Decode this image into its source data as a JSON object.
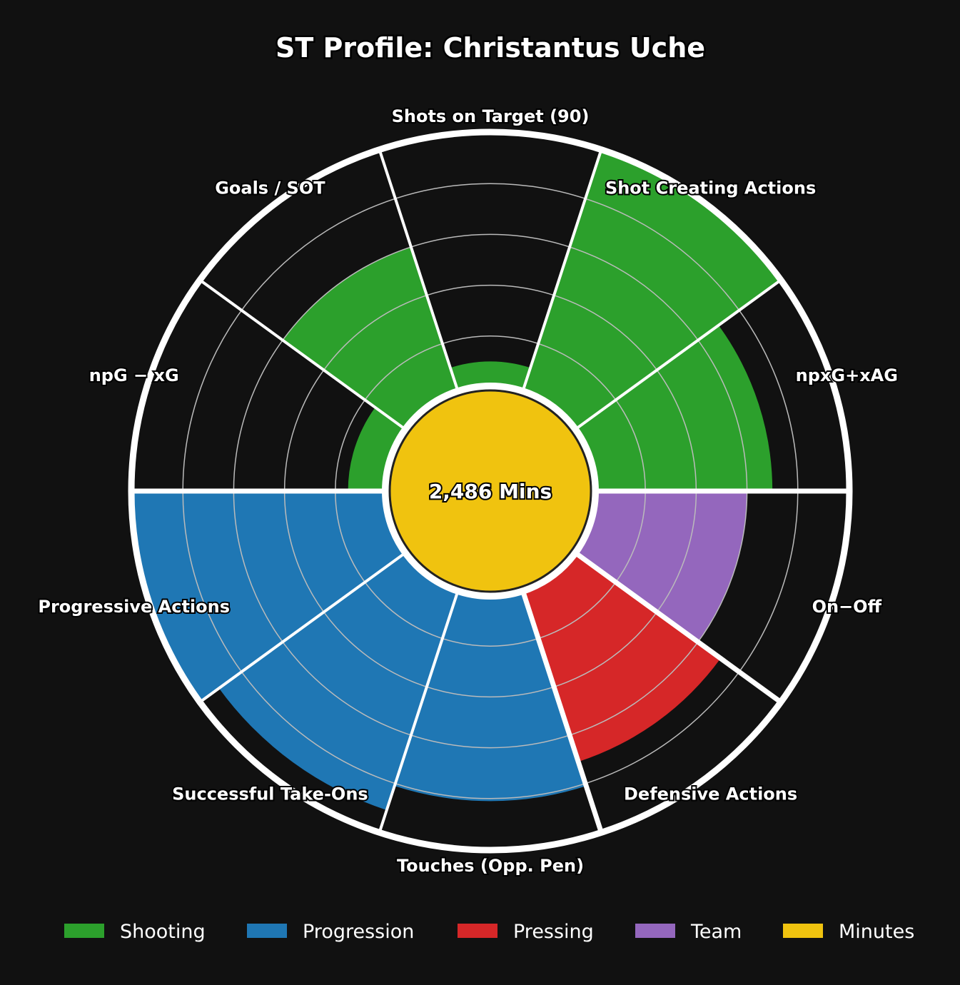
{
  "chart_data": {
    "type": "polar-bar",
    "title": "ST Profile: Christantus Uche",
    "center_label": "2,486 Mins",
    "radial_max": 100,
    "rings": [
      20,
      40,
      60,
      80
    ],
    "categories": [
      {
        "label": "Shots on Target (90)",
        "group": "Shooting",
        "value": 10
      },
      {
        "label": "Shot Creating Actions",
        "group": "Shooting",
        "value": 100
      },
      {
        "label": "npxG+xAG",
        "group": "Shooting",
        "value": 70
      },
      {
        "label": "On−Off",
        "group": "Team",
        "value": 60
      },
      {
        "label": "Defensive Actions",
        "group": "Pressing",
        "value": 71
      },
      {
        "label": "Touches (Opp. Pen)",
        "group": "Progression",
        "value": 81
      },
      {
        "label": "Successful Take-Ons",
        "group": "Progression",
        "value": 91
      },
      {
        "label": "Progressive Actions",
        "group": "Progression",
        "value": 100
      },
      {
        "label": "npG − xG",
        "group": "Shooting",
        "value": 15
      },
      {
        "label": "Goals / SOT",
        "group": "Shooting",
        "value": 60
      }
    ],
    "legend": [
      {
        "name": "Shooting",
        "color": "#2ca02c"
      },
      {
        "name": "Progression",
        "color": "#1f77b4"
      },
      {
        "name": "Pressing",
        "color": "#d62728"
      },
      {
        "name": "Team",
        "color": "#9467bd"
      },
      {
        "name": "Minutes",
        "color": "#f0c30f"
      }
    ]
  }
}
